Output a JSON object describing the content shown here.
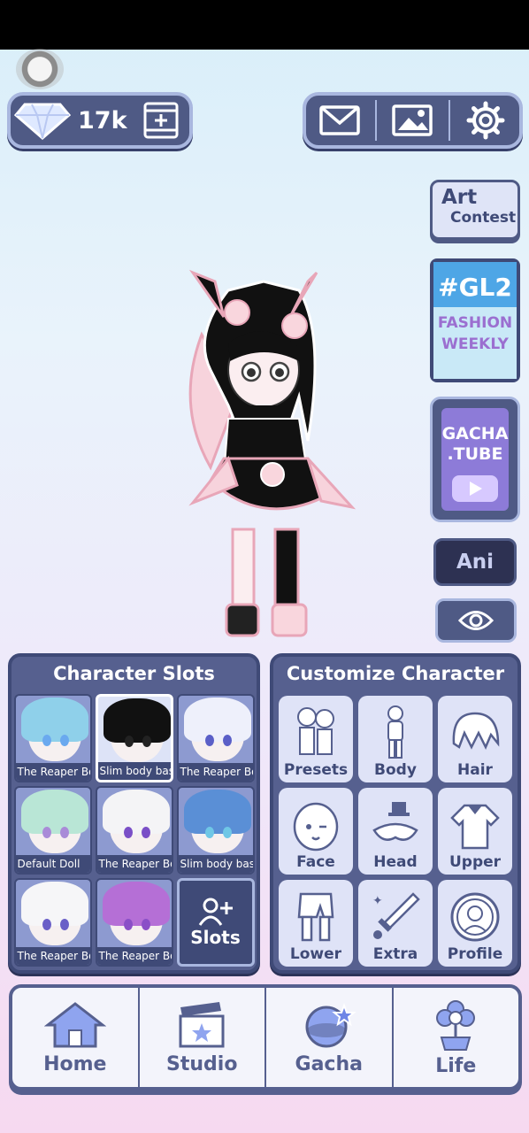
{
  "currency": {
    "gems": "17k",
    "icon": "diamond-icon",
    "add_icon": "add-gems-icon"
  },
  "top_actions": [
    {
      "name": "mail-icon"
    },
    {
      "name": "gallery-icon"
    },
    {
      "name": "settings-icon"
    }
  ],
  "side": {
    "art_line1": "Art",
    "art_line2": "Contest",
    "gl2_title": "#GL2",
    "gl2_line1": "FASHION",
    "gl2_line2": "WEEKLY",
    "tube_line1": "GACHA",
    "tube_line2": ".TUBE",
    "ani": "Ani"
  },
  "slots": {
    "title": "Character Slots",
    "items": [
      {
        "label": "The Reaper Bo"
      },
      {
        "label": "Slim body bas"
      },
      {
        "label": "The Reaper Bo"
      },
      {
        "label": "Default Doll"
      },
      {
        "label": "The Reaper Bo"
      },
      {
        "label": "Slim body bas"
      },
      {
        "label": "The Reaper Bo"
      },
      {
        "label": "The Reaper Bo"
      }
    ],
    "add_label": "Slots"
  },
  "customize": {
    "title": "Customize Character",
    "items": [
      {
        "label": "Presets"
      },
      {
        "label": "Body"
      },
      {
        "label": "Hair"
      },
      {
        "label": "Face"
      },
      {
        "label": "Head"
      },
      {
        "label": "Upper"
      },
      {
        "label": "Lower"
      },
      {
        "label": "Extra"
      },
      {
        "label": "Profile"
      }
    ]
  },
  "nav": [
    {
      "label": "Home"
    },
    {
      "label": "Studio"
    },
    {
      "label": "Gacha"
    },
    {
      "label": "Life"
    }
  ],
  "colors": {
    "panel": "#56608f",
    "panel_dark": "#3f4a77",
    "accent_blue": "#4ea6e6",
    "accent_purple": "#8d7bd8"
  }
}
